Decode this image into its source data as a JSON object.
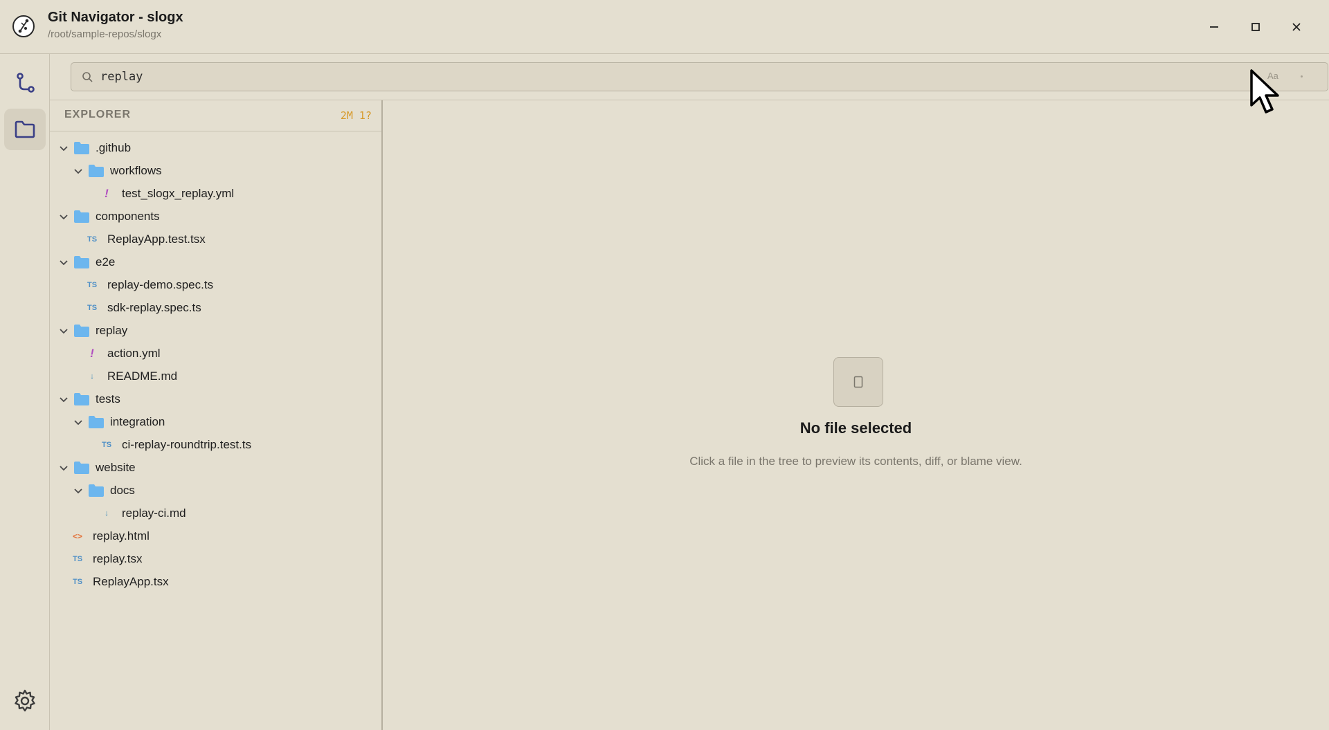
{
  "window": {
    "title": "Git Navigator - slogx",
    "path": "/root/sample-repos/slogx"
  },
  "search": {
    "value": "replay",
    "case_toggle": "Aa"
  },
  "explorer": {
    "title": "EXPLORER",
    "status": "2M 1?",
    "tree": [
      {
        "label": ".github",
        "type": "folder",
        "depth": 0
      },
      {
        "label": "workflows",
        "type": "folder",
        "depth": 1
      },
      {
        "label": "test_slogx_replay.yml",
        "type": "yml",
        "depth": 2
      },
      {
        "label": "components",
        "type": "folder",
        "depth": 0
      },
      {
        "label": "ReplayApp.test.tsx",
        "type": "ts",
        "depth": 1
      },
      {
        "label": "e2e",
        "type": "folder",
        "depth": 0
      },
      {
        "label": "replay-demo.spec.ts",
        "type": "ts",
        "depth": 1
      },
      {
        "label": "sdk-replay.spec.ts",
        "type": "ts",
        "depth": 1
      },
      {
        "label": "replay",
        "type": "folder",
        "depth": 0
      },
      {
        "label": "action.yml",
        "type": "yml",
        "depth": 1
      },
      {
        "label": "README.md",
        "type": "md",
        "depth": 1
      },
      {
        "label": "tests",
        "type": "folder",
        "depth": 0
      },
      {
        "label": "integration",
        "type": "folder",
        "depth": 1
      },
      {
        "label": "ci-replay-roundtrip.test.ts",
        "type": "ts",
        "depth": 2
      },
      {
        "label": "website",
        "type": "folder",
        "depth": 0
      },
      {
        "label": "docs",
        "type": "folder",
        "depth": 1
      },
      {
        "label": "replay-ci.md",
        "type": "md",
        "depth": 2
      },
      {
        "label": "replay.html",
        "type": "html",
        "depth": 0
      },
      {
        "label": "replay.tsx",
        "type": "ts",
        "depth": 0
      },
      {
        "label": "ReplayApp.tsx",
        "type": "ts",
        "depth": 0
      }
    ]
  },
  "preview": {
    "empty_title": "No file selected",
    "empty_desc": "Click a file in the tree to preview its contents, diff, or blame view."
  },
  "icons": {
    "ts_glyph": "TS",
    "yml_glyph": "!",
    "md_glyph": "↓",
    "html_glyph": "<>"
  },
  "colors": {
    "background": "#e4dfd0",
    "folder": "#6cb6ee",
    "status": "#d79a2b",
    "active_icon": "#3a3f86"
  }
}
